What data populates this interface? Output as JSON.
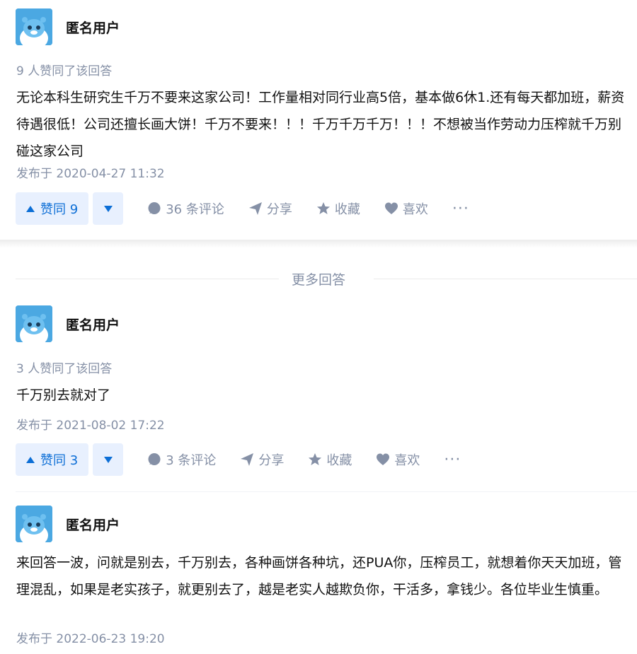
{
  "answers": [
    {
      "author": "匿名用户",
      "vote_info": "9 人赞同了该回答",
      "content": "无论本科生研究生千万不要来这家公司！工作量相对同行业高5倍，基本做6休1.还有每天都加班，薪资待遇很低！公司还擅长画大饼！千万不要来！！！千万千万千万！！！不想被当作劳动力压榨就千万别碰这家公司",
      "time": "发布于 2020-04-27 11:32",
      "vote_up": "赞同 9",
      "comments": "36 条评论",
      "share": "分享",
      "collect": "收藏",
      "like": "喜欢",
      "more": "···"
    },
    {
      "author": "匿名用户",
      "vote_info": "3 人赞同了该回答",
      "content": "千万别去就对了",
      "time": "发布于 2021-08-02 17:22",
      "vote_up": "赞同 3",
      "comments": "3 条评论",
      "share": "分享",
      "collect": "收藏",
      "like": "喜欢",
      "more": "···"
    },
    {
      "author": "匿名用户",
      "content": "来回答一波，问就是别去，千万别去，各种画饼各种坑，还PUA你，压榨员工，就想着你天天加班，管理混乱，如果是老实孩子，就更别去了，越是老实人越欺负你，干活多，拿钱少。各位毕业生慎重。",
      "time": "发布于 2022-06-23 19:20"
    }
  ],
  "more_answers_label": "更多回答",
  "colors": {
    "accent": "#0c6ed6",
    "vote_bg": "#e8f0fe",
    "muted": "#8590a6",
    "avatar_bg": "#4ba8e2"
  },
  "icons": [
    "avatar-icon",
    "vote-up-icon",
    "vote-down-icon",
    "comment-icon",
    "share-icon",
    "star-icon",
    "heart-icon",
    "more-icon"
  ]
}
